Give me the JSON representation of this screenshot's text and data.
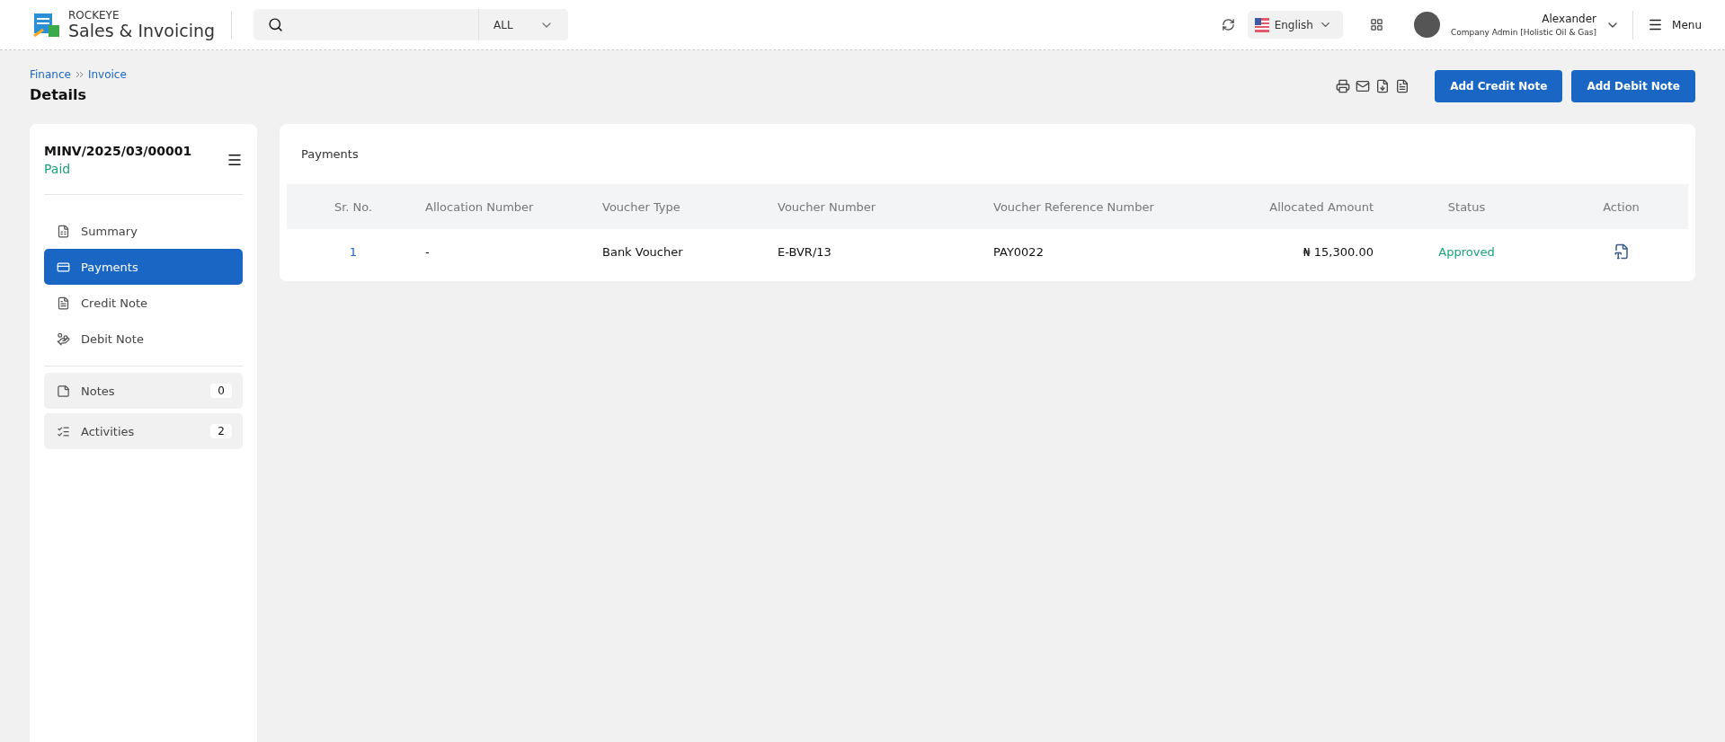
{
  "app": {
    "brand_small": "ROCKEYE",
    "brand_large": "Sales & Invoicing"
  },
  "search": {
    "scope": "ALL"
  },
  "language": {
    "label": "English"
  },
  "user": {
    "name": "Alexander",
    "role": "Company Admin [Holistic Oil & Gas]"
  },
  "menu": {
    "label": "Menu"
  },
  "breadcrumb": [
    "Finance",
    "Invoice"
  ],
  "page_title": "Details",
  "actions": [
    "Add Credit Note",
    "Add Debit Note"
  ],
  "invoice": {
    "number": "MINV/2025/03/00001",
    "status": "Paid"
  },
  "nav": [
    {
      "kind": "link",
      "label": "Summary",
      "selected": false
    },
    {
      "kind": "link",
      "label": "Payments",
      "selected": true
    },
    {
      "kind": "link",
      "label": "Credit Note",
      "selected": false
    },
    {
      "kind": "link",
      "label": "Debit Note",
      "selected": false
    },
    {
      "kind": "counter",
      "label": "Notes",
      "count": "0",
      "selected": false
    },
    {
      "kind": "counter",
      "label": "Activities",
      "count": "2",
      "selected": false
    }
  ],
  "panel": {
    "title": "Payments"
  },
  "table": {
    "columns": [
      "Sr. No.",
      "Allocation Number",
      "Voucher Type",
      "Voucher Number",
      "Voucher Reference Number",
      "Allocated Amount",
      "Status",
      "Action"
    ],
    "rows": [
      {
        "cells": [
          "1",
          "-",
          "Bank Voucher",
          "E-BVR/13",
          "PAY0022",
          "₦ 15,300.00",
          "Approved"
        ]
      }
    ]
  }
}
